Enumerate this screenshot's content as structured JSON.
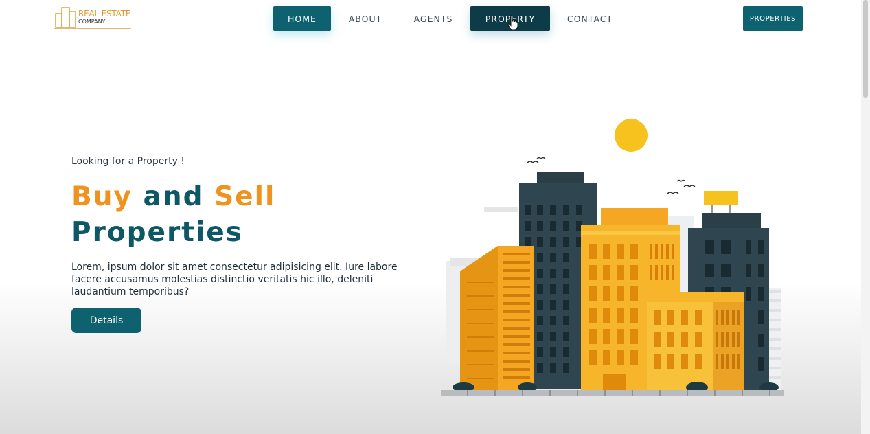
{
  "logo": {
    "line1": "REAL ESTATE",
    "line2": "COMPANY"
  },
  "nav": {
    "items": [
      "HOME",
      "ABOUT",
      "AGENTS",
      "PROPERTY",
      "CONTACT"
    ]
  },
  "header": {
    "properties_button": "PROPERTIES"
  },
  "hero": {
    "tagline": "Looking for a Property !",
    "title_word1": "Buy",
    "title_word2": "and",
    "title_word3": "Sell",
    "title_line2": "Properties",
    "description": "Lorem, ipsum dolor sit amet consectetur adipisicing elit. Iure labore facere accusamus molestias distinctio veritatis hic illo, deleniti laudantium temporibus?",
    "details_button": "Details"
  },
  "colors": {
    "primary": "#0e6270",
    "dark_teal": "#0d3b48",
    "accent": "#f0921e",
    "building_yellow": "#f7b52b",
    "building_dark": "#2f4650"
  }
}
